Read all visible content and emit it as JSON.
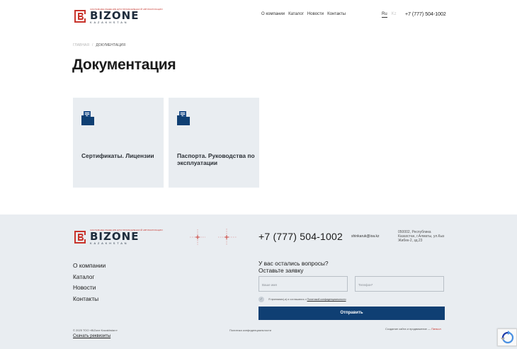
{
  "header": {
    "logo": {
      "tagline": "СИСТЕМНЫЕ РЕШЕНИЯ ДЛЯ ПРОМЫШЛЕННОЙ АВТОМАТИЗАЦИИ",
      "name": "BIZONE",
      "sub": "KAZAKHSTAN"
    },
    "nav": [
      "О компании",
      "Каталог",
      "Новости",
      "Контакты"
    ],
    "lang": {
      "active": "Ru",
      "inactive": "Kz"
    },
    "phone": "+7 (777) 504-1002"
  },
  "main": {
    "breadcrumb": {
      "home": "Главная",
      "separator": "/",
      "current": "Документация"
    },
    "title": "Документация",
    "cards": [
      {
        "title": "Сертификаты. Лицензии",
        "icon": "folder-document-icon"
      },
      {
        "title": "Паспорта. Руководства по эксплуатации",
        "icon": "folder-document-icon"
      }
    ]
  },
  "footer": {
    "phone": "+7 (777) 504-1002",
    "email": "shinkaruk@ioa.kz",
    "address": "050002, Республика Казахстан, г.Алматы, ул.Кыз Жибек-2, зд.23",
    "nav": [
      "О компании",
      "Каталог",
      "Новости",
      "Контакты"
    ],
    "form": {
      "heading_line1": "У вас остались вопросы?",
      "heading_line2": "Оставьте заявку",
      "name_placeholder": "Ваше имя",
      "phone_placeholder": "Телефон*",
      "consent_text": "Я принимаю(-а) и соглашаюсь с",
      "consent_link": "Политикой конфиденциальности",
      "submit_label": "Отправить"
    },
    "copyright": "© 2025 ТОО «BiZone Kazakhstan»",
    "requisites": "Скачать реквизиты",
    "privacy": "Политика конфиденциальности",
    "dev_text": "Создание сайта и продвижение —",
    "dev_name": "Пинкол"
  },
  "colors": {
    "brand_red": "#c8342c",
    "brand_navy": "#1e2c3c",
    "button_blue": "#0f3f73",
    "card_bg": "#e9edf1"
  }
}
